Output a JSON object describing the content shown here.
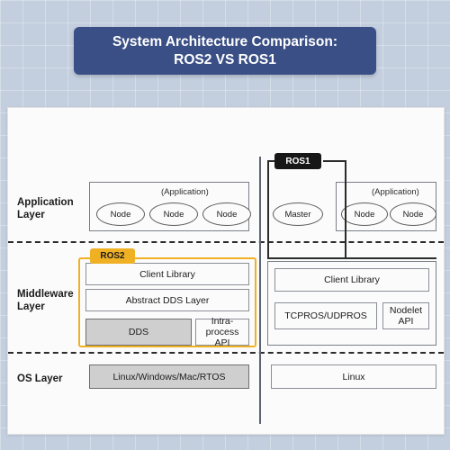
{
  "title": {
    "line1": "System Architecture Comparison:",
    "line2": "ROS2 VS ROS1",
    "background_color": "#3a4f85",
    "text_color": "#ffffff"
  },
  "page": {
    "background_color": "#c3cede",
    "card_color": "#fbfbfb"
  },
  "layers": {
    "application": "Application\nLayer",
    "application_line1": "Application",
    "application_line2": "Layer",
    "middleware_line1": "Middleware",
    "middleware_line2": "Layer",
    "os": "OS Layer"
  },
  "badges": {
    "ros2": "ROS2",
    "ros2_color": "#efb024",
    "ros1": "ROS1",
    "ros1_color": "#171717"
  },
  "ros2": {
    "application": {
      "caption": "(Application)",
      "nodes": [
        "Node",
        "Node",
        "Node"
      ]
    },
    "middleware": {
      "client_library": "Client Library",
      "abstract_dds": "Abstract DDS Layer",
      "dds": "DDS",
      "intra_process_line1": "Intra-process",
      "intra_process_line2": "API"
    },
    "os": "Linux/Windows/Mac/RTOS"
  },
  "ros1": {
    "application": {
      "master": "Master",
      "caption": "(Application)",
      "nodes": [
        "Node",
        "Node"
      ]
    },
    "middleware": {
      "client_library": "Client Library",
      "tcpros_udpros": "TCPROS/UDPROS",
      "nodelet_line1": "Nodelet",
      "nodelet_line2": "API"
    },
    "os": "Linux"
  }
}
